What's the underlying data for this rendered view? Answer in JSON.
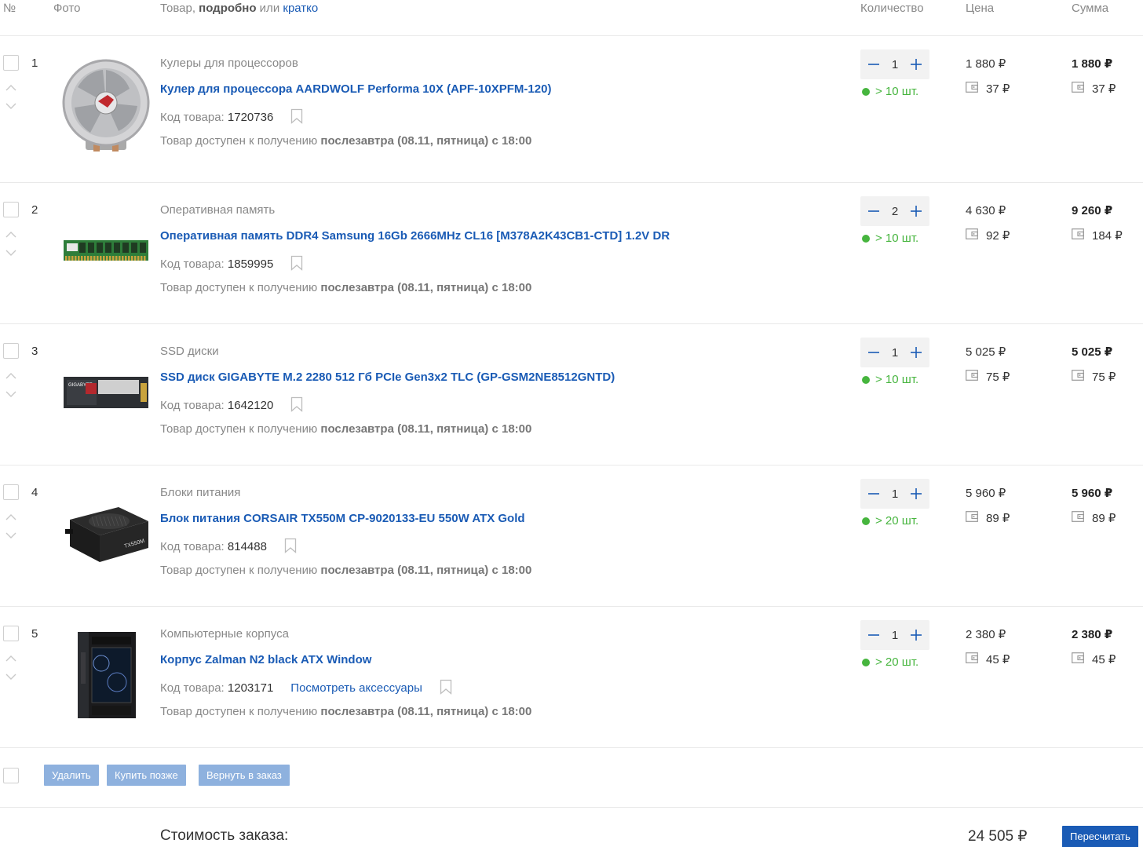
{
  "header": {
    "num": "№",
    "photo": "Фото",
    "product_prefix": "Товар, ",
    "product_detailed": "подробно",
    "product_or": " или ",
    "product_brief": "кратко",
    "quantity": "Количество",
    "price": "Цена",
    "sum": "Сумма"
  },
  "labels": {
    "code": "Код товара: ",
    "avail_prefix": "Товар доступен к получению ",
    "avail_bold": "послезавтра (08.11, пятница) с 18:00",
    "accessories": "Посмотреть аксессуары"
  },
  "colors": {
    "link": "#1a5bb5",
    "in_stock": "#46b53e",
    "action_button": "#8eb1de",
    "primary_button": "#1a5bb5"
  },
  "items": [
    {
      "index": "1",
      "category": "Кулеры для процессоров",
      "name": "Кулер для процессора AARDWOLF Performa 10X (APF-10XPFM-120)",
      "code": "1720736",
      "quantity": "1",
      "stock": "> 10 шт.",
      "price": "1 880 ₽",
      "price_bonus": "37 ₽",
      "sum": "1 880 ₽",
      "sum_bonus": "37 ₽",
      "image": "cpu-cooler"
    },
    {
      "index": "2",
      "category": "Оперативная память",
      "name": "Оперативная память DDR4 Samsung 16Gb 2666MHz CL16 [M378A2K43CB1-CTD] 1.2V DR",
      "code": "1859995",
      "quantity": "2",
      "stock": "> 10 шт.",
      "price": "4 630 ₽",
      "price_bonus": "92 ₽",
      "sum": "9 260 ₽",
      "sum_bonus": "184 ₽",
      "image": "ram-module"
    },
    {
      "index": "3",
      "category": "SSD диски",
      "name": "SSD диск GIGABYTE M.2 2280 512 Гб PCIe Gen3x2 TLC (GP-GSM2NE8512GNTD)",
      "code": "1642120",
      "quantity": "1",
      "stock": "> 10 шт.",
      "price": "5 025 ₽",
      "price_bonus": "75 ₽",
      "sum": "5 025 ₽",
      "sum_bonus": "75 ₽",
      "image": "m2-ssd",
      "image_text": "GIGABYTE"
    },
    {
      "index": "4",
      "category": "Блоки питания",
      "name": "Блок питания CORSAIR TX550M CP-9020133-EU 550W ATX Gold",
      "code": "814488",
      "quantity": "1",
      "stock": "> 20 шт.",
      "price": "5 960 ₽",
      "price_bonus": "89 ₽",
      "sum": "5 960 ₽",
      "sum_bonus": "89 ₽",
      "image": "power-supply",
      "image_text": "TX550M"
    },
    {
      "index": "5",
      "category": "Компьютерные корпуса",
      "name": "Корпус Zalman N2 black ATX Window",
      "code": "1203171",
      "quantity": "1",
      "stock": "> 20 шт.",
      "price": "2 380 ₽",
      "price_bonus": "45 ₽",
      "sum": "2 380 ₽",
      "sum_bonus": "45 ₽",
      "image": "pc-case",
      "has_accessories": true
    }
  ],
  "actions": {
    "delete": "Удалить",
    "buy_later": "Купить позже",
    "return_to_order": "Вернуть в заказ"
  },
  "total": {
    "label": "Стоимость заказа:",
    "value": "24 505 ₽",
    "recalc": "Пересчитать"
  }
}
